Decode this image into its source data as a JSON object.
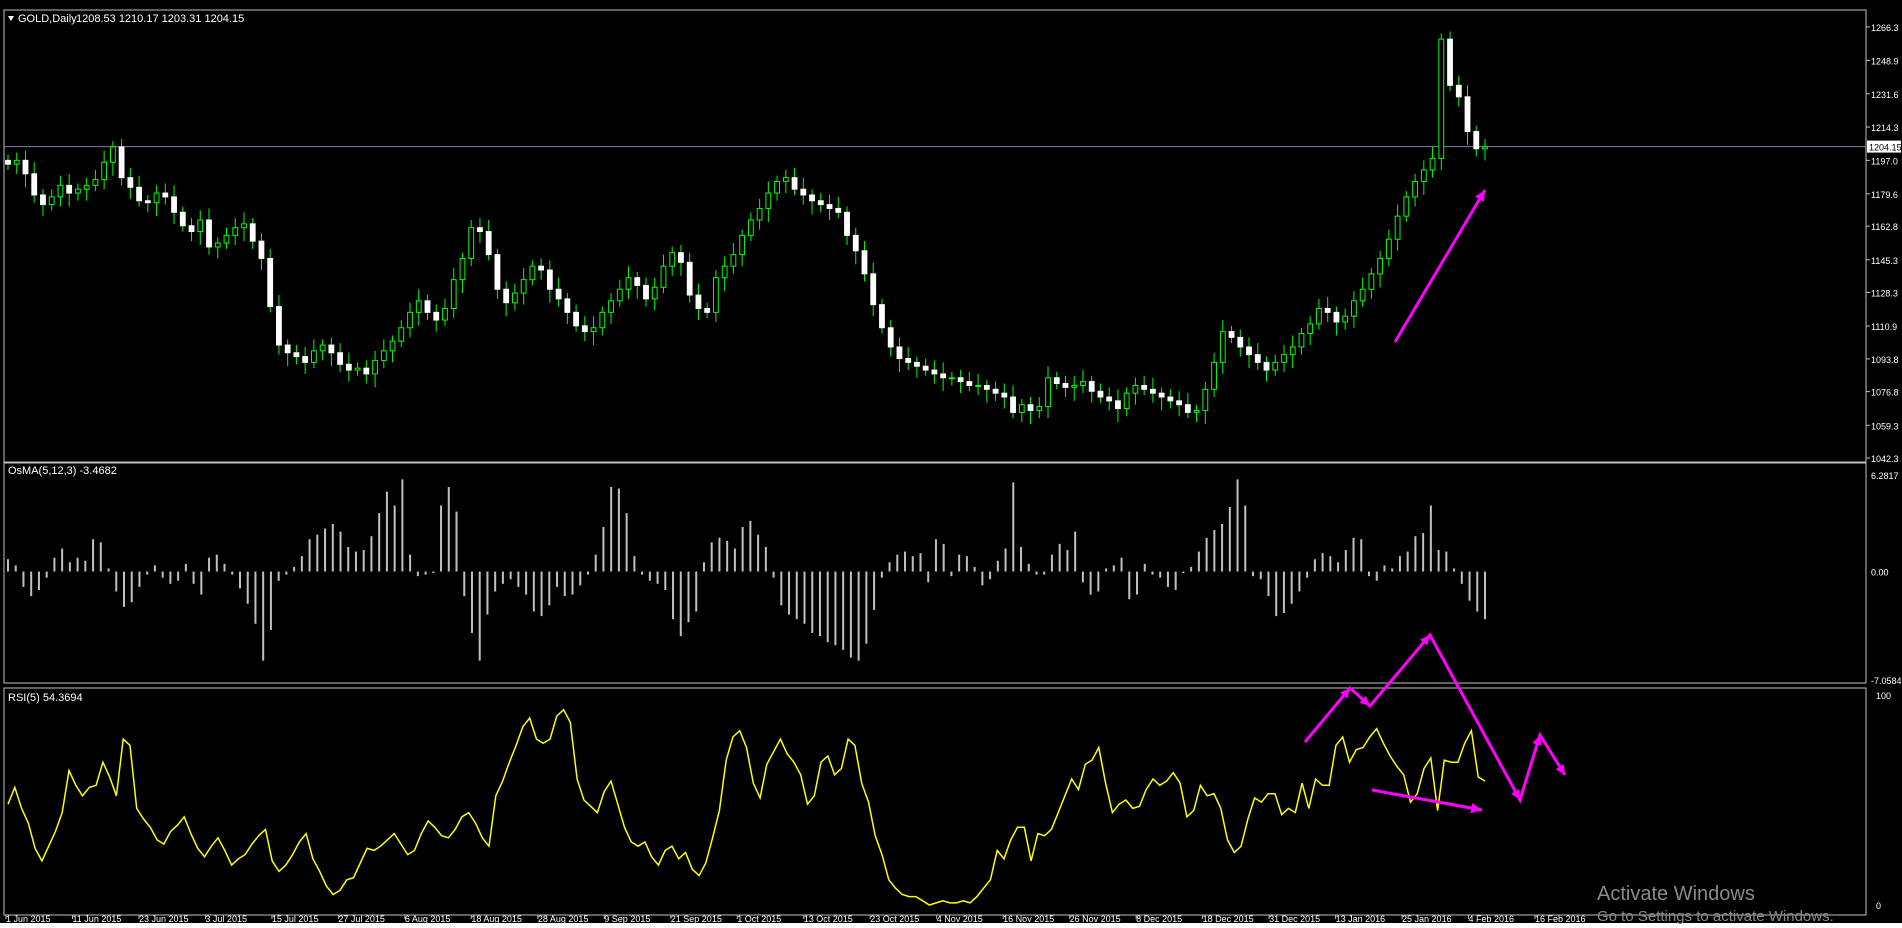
{
  "chart_data": [
    {
      "type": "candlestick",
      "title": "GOLD,Daily",
      "ohlc_header": "1208.53 1210.17 1203.31 1204.15",
      "current_price_label": "1204.15",
      "y_ticks": [
        "1266.3",
        "1248.9",
        "1231.6",
        "1214.3",
        "1197.0",
        "1179.6",
        "1162.8",
        "1145.3",
        "1128.3",
        "1110.9",
        "1093.8",
        "1076.8",
        "1059.3",
        "1042.3"
      ],
      "ylim": [
        1042.3,
        1266.3
      ],
      "close": [
        1195,
        1197,
        1190,
        1179,
        1174,
        1178,
        1184,
        1180,
        1182,
        1184,
        1187,
        1196,
        1204,
        1188,
        1183,
        1176,
        1175,
        1180,
        1178,
        1170,
        1163,
        1160,
        1166,
        1152,
        1154,
        1158,
        1162,
        1164,
        1155,
        1146,
        1121,
        1101,
        1097,
        1095,
        1092,
        1098,
        1101,
        1097,
        1091,
        1088,
        1089,
        1086,
        1093,
        1098,
        1103,
        1110,
        1118,
        1124,
        1118,
        1114,
        1120,
        1135,
        1146,
        1162,
        1160,
        1148,
        1130,
        1123,
        1128,
        1135,
        1142,
        1140,
        1130,
        1125,
        1118,
        1111,
        1108,
        1110,
        1118,
        1124,
        1130,
        1136,
        1132,
        1125,
        1131,
        1142,
        1149,
        1144,
        1127,
        1120,
        1118,
        1136,
        1142,
        1148,
        1158,
        1166,
        1172,
        1180,
        1186,
        1188,
        1182,
        1179,
        1176,
        1174,
        1172,
        1170,
        1158,
        1150,
        1138,
        1122,
        1110,
        1100,
        1094,
        1092,
        1090,
        1088,
        1086,
        1084,
        1084,
        1082,
        1080,
        1080,
        1078,
        1076,
        1074,
        1066,
        1070,
        1067,
        1069,
        1084,
        1081,
        1079,
        1080,
        1082,
        1077,
        1074,
        1072,
        1068,
        1076,
        1080,
        1078,
        1076,
        1074,
        1072,
        1070,
        1066,
        1067,
        1078,
        1092,
        1108,
        1105,
        1100,
        1096,
        1092,
        1088,
        1092,
        1096,
        1100,
        1107,
        1112,
        1120,
        1118,
        1113,
        1116,
        1124,
        1130,
        1138,
        1146,
        1156,
        1168,
        1178,
        1186,
        1192,
        1198,
        1260,
        1236,
        1230,
        1212,
        1203,
        1204
      ],
      "osma_label": "OsMA(5,12,3) -3.4682",
      "osma_ticks": [
        "6.2817",
        "0.00",
        "-7.0584"
      ],
      "osma": [
        0.8,
        0.4,
        -1.0,
        -1.6,
        -1.2,
        -0.4,
        0.9,
        1.5,
        0.6,
        0.9,
        0.7,
        2.1,
        1.9,
        0.2,
        -1.3,
        -2.3,
        -2.0,
        -1.0,
        -0.2,
        0.4,
        -0.4,
        -0.8,
        -0.6,
        0.5,
        -0.8,
        -1.5,
        0.9,
        1.1,
        0.5,
        -0.2,
        -1.1,
        -2.1,
        -3.4,
        -5.8,
        -3.8,
        -0.6,
        -0.2,
        0.3,
        1.0,
        2.1,
        2.4,
        2.8,
        3.1,
        2.6,
        1.6,
        1.3,
        1.4,
        2.3,
        3.8,
        5.2,
        4.3,
        6.0,
        1.1,
        -0.3,
        -0.2,
        -0.1,
        4.3,
        5.5,
        3.9,
        -1.6,
        -4.0,
        -5.8,
        -2.8,
        -1.3,
        -0.8,
        -0.5,
        -1.0,
        -1.5,
        -2.6,
        -2.9,
        -2.2,
        -1.0,
        -1.6,
        -1.5,
        -0.9,
        -0.2,
        1.1,
        2.9,
        5.5,
        5.4,
        3.8,
        1.0,
        -0.2,
        -0.6,
        -0.8,
        -1.2,
        -3.1,
        -4.2,
        -3.3,
        -2.6,
        0.6,
        1.9,
        2.2,
        2.0,
        1.5,
        2.9,
        3.3,
        2.4,
        1.6,
        -0.4,
        -2.2,
        -2.8,
        -3.1,
        -3.4,
        -4.0,
        -4.2,
        -4.6,
        -4.8,
        -5.1,
        -5.6,
        -5.8,
        -4.7,
        -2.5,
        -0.4,
        0.6,
        1.1,
        1.3,
        1.0,
        1.2,
        -0.7,
        2.1,
        1.8,
        -0.3,
        1.1,
        1.0,
        0.3,
        -0.9,
        -0.5,
        0.7,
        1.5,
        5.8,
        1.6,
        0.5,
        -0.2,
        -0.2,
        1.1,
        1.8,
        1.4,
        2.6,
        -0.7,
        -1.5,
        -1.3,
        0.2,
        0.4,
        0.9,
        -1.8,
        -1.5,
        0.5,
        -0.2,
        -0.4,
        -1.0,
        -1.2,
        -0.1,
        0.3,
        1.3,
        2.2,
        2.7,
        3.1,
        4.2,
        6.0,
        4.3,
        -0.3,
        -0.5,
        -1.6,
        -2.9,
        -2.7,
        -2.1,
        -1.3,
        -0.4,
        0.8,
        1.2,
        1.0,
        0.6,
        1.4,
        2.2,
        2.1,
        -0.3,
        -0.6,
        0.4,
        0.2,
        1.0,
        1.3,
        2.3,
        2.5,
        4.3,
        1.4,
        1.3,
        0.2,
        -0.8,
        -1.9,
        -2.6,
        -3.1
      ],
      "rsi_label": "RSI(5) 54.3694",
      "rsi_ticks": [
        "100",
        "0"
      ],
      "ylim_rsi": [
        0,
        100
      ],
      "rsi": [
        48,
        56,
        46,
        39,
        27,
        21,
        28,
        35,
        44,
        64,
        57,
        52,
        56,
        57,
        68,
        61,
        52,
        79,
        76,
        46,
        41,
        37,
        31,
        29,
        35,
        38,
        42,
        34,
        27,
        23,
        28,
        32,
        26,
        19,
        22,
        24,
        29,
        33,
        36,
        21,
        16,
        19,
        24,
        30,
        34,
        22,
        16,
        9,
        5,
        7,
        12,
        13,
        20,
        27,
        26,
        28,
        31,
        34,
        29,
        24,
        26,
        34,
        40,
        37,
        33,
        32,
        36,
        42,
        44,
        39,
        32,
        28,
        52,
        59,
        68,
        76,
        85,
        89,
        79,
        77,
        79,
        90,
        93,
        87,
        60,
        50,
        47,
        44,
        54,
        59,
        48,
        37,
        30,
        28,
        30,
        23,
        19,
        26,
        28,
        22,
        25,
        17,
        14,
        20,
        32,
        45,
        69,
        80,
        83,
        75,
        58,
        51,
        67,
        73,
        79,
        72,
        68,
        62,
        48,
        52,
        68,
        71,
        62,
        65,
        79,
        76,
        58,
        49,
        33,
        24,
        12,
        8,
        5,
        4,
        4,
        2,
        0,
        1,
        2,
        1,
        1,
        2,
        1,
        4,
        8,
        12,
        26,
        22,
        31,
        37,
        37,
        21,
        34,
        33,
        36,
        44,
        52,
        60,
        55,
        67,
        69,
        75,
        58,
        44,
        48,
        50,
        46,
        47,
        55,
        60,
        57,
        59,
        63,
        58,
        42,
        45,
        57,
        52,
        53,
        46,
        31,
        25,
        28,
        41,
        51,
        49,
        53,
        53,
        43,
        46,
        44,
        58,
        46,
        60,
        57,
        57,
        76,
        80,
        68,
        74,
        75,
        80,
        84,
        77,
        71,
        66,
        62,
        49,
        53,
        65,
        70,
        45,
        69,
        68,
        68,
        77,
        83,
        61,
        59
      ]
    }
  ],
  "x_labels": [
    "1 Jun 2015",
    "11 Jun 2015",
    "23 Jun 2015",
    "3 Jul 2015",
    "15 Jul 2015",
    "27 Jul 2015",
    "6 Aug 2015",
    "18 Aug 2015",
    "28 Aug 2015",
    "9 Sep 2015",
    "21 Sep 2015",
    "1 Oct 2015",
    "13 Oct 2015",
    "23 Oct 2015",
    "4 Nov 2015",
    "16 Nov 2015",
    "26 Nov 2015",
    "8 Dec 2015",
    "18 Dec 2015",
    "31 Dec 2015",
    "13 Jan 2016",
    "25 Jan 2016",
    "4 Feb 2016",
    "16 Feb 2016"
  ],
  "watermark": {
    "line1": "Activate Windows",
    "line2": "Go to Settings to activate Windows."
  },
  "colors": {
    "background": "#000000",
    "grid_axis": "#c0c0c0",
    "candle": "#ffffff",
    "wick_up": "#00ff00",
    "histogram": "#c0c0c0",
    "rsi_line": "#ffff00",
    "annotation": "#ff00ff",
    "price_line": "#8080a0"
  }
}
